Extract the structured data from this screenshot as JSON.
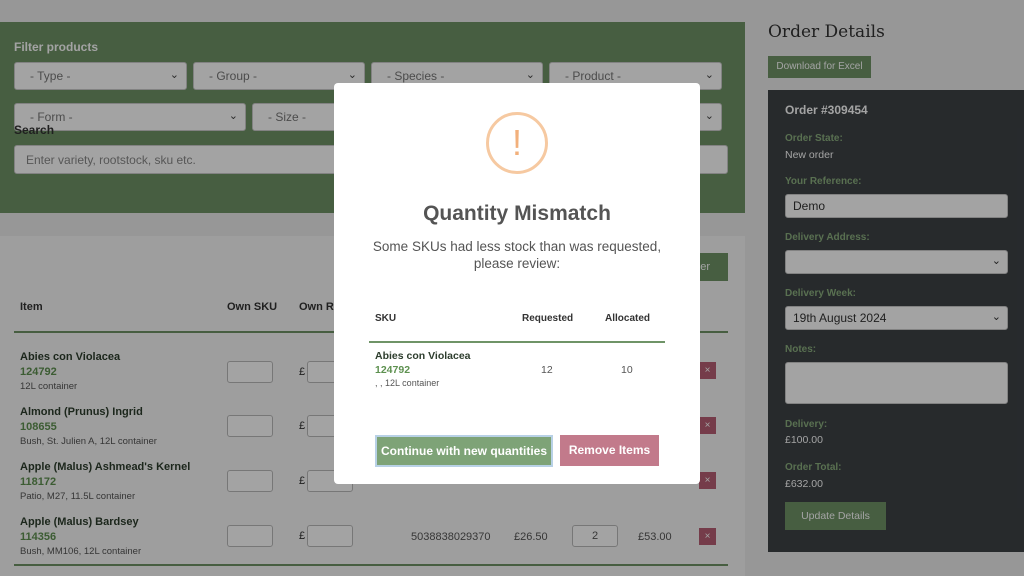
{
  "filters": {
    "title": "Filter products",
    "type": "- Type -",
    "group": "- Group -",
    "species": "- Species -",
    "product": "- Product -",
    "form": "- Form -",
    "size": "- Size -",
    "search_label": "Search",
    "search_placeholder": "Enter variety, rootstock, sku etc."
  },
  "partial_button_label": "er",
  "table": {
    "headers": {
      "item": "Item",
      "own_sku": "Own SKU",
      "own_retail": "Own Re"
    },
    "rows": [
      {
        "name": "Abies con Violacea",
        "sku": "124792",
        "desc": "12L container"
      },
      {
        "name": "Almond (Prunus) Ingrid",
        "sku": "108655",
        "desc": "Bush, St. Julien A, 12L container"
      },
      {
        "name": "Apple (Malus) Ashmead's Kernel",
        "sku": "118172",
        "desc": "Patio, M27, 11.5L container"
      },
      {
        "name": "Apple (Malus) Bardsey",
        "sku": "114356",
        "desc": "Bush, MM106, 12L container",
        "barcode": "5038838029370",
        "price": "£26.50",
        "qty": "2",
        "total": "£53.00"
      }
    ],
    "currency": "£",
    "delete_symbol": "×"
  },
  "order": {
    "title": "Order Details",
    "download_label": "Download for Excel",
    "number": "Order #309454",
    "state_label": "Order State:",
    "state_value": "New order",
    "reference_label": "Your Reference:",
    "reference_value": "Demo",
    "address_label": "Delivery Address:",
    "week_label": "Delivery Week:",
    "week_value": "19th August 2024",
    "notes_label": "Notes:",
    "delivery_label": "Delivery:",
    "delivery_value": "£100.00",
    "total_label": "Order Total:",
    "total_value": "£632.00",
    "update_label": "Update Details"
  },
  "modal": {
    "icon": "!",
    "title": "Quantity Mismatch",
    "message": "Some SKUs had less stock than was requested, please review:",
    "headers": {
      "sku": "SKU",
      "requested": "Requested",
      "allocated": "Allocated"
    },
    "row": {
      "name": "Abies con Violacea",
      "sku": "124792",
      "desc": ", , 12L container",
      "requested": "12",
      "allocated": "10"
    },
    "continue_label": "Continue with new quantities",
    "remove_label": "Remove Items"
  },
  "colors": {
    "green": "#6f9467",
    "dark_panel": "#3d4246",
    "red": "#b75e74",
    "warning": "#f2b07b"
  }
}
